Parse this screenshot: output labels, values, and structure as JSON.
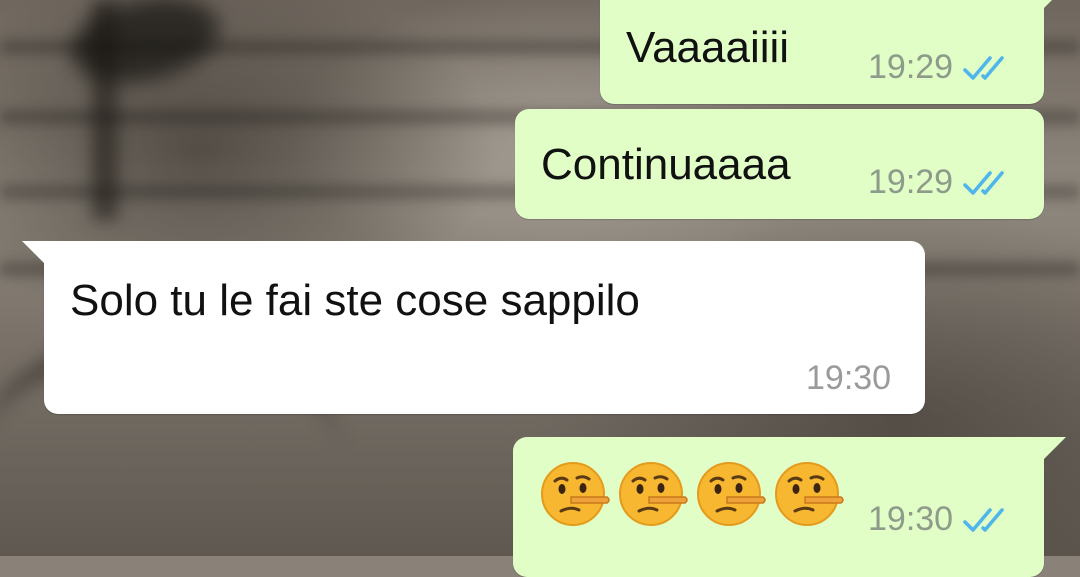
{
  "chat": {
    "messages": [
      {
        "direction": "outgoing",
        "text": "Vaaaaiiii",
        "time": "19:29",
        "status": "read",
        "status_icon": "double-check-icon"
      },
      {
        "direction": "outgoing",
        "text": "Continuaaaa",
        "time": "19:29",
        "status": "read",
        "status_icon": "double-check-icon"
      },
      {
        "direction": "incoming",
        "text": "Solo tu le fai ste cose sappilo",
        "time": "19:30"
      },
      {
        "direction": "outgoing",
        "text": "🤥🤥🤥🤥",
        "emoji": [
          "lying-face",
          "lying-face",
          "lying-face",
          "lying-face"
        ],
        "time": "19:30",
        "status": "read",
        "status_icon": "double-check-icon"
      }
    ]
  },
  "colors": {
    "outgoing_bubble": "#e1fec6",
    "incoming_bubble": "#ffffff",
    "read_ticks": "#4fb6ec",
    "timestamp": "#8e9a8a"
  }
}
